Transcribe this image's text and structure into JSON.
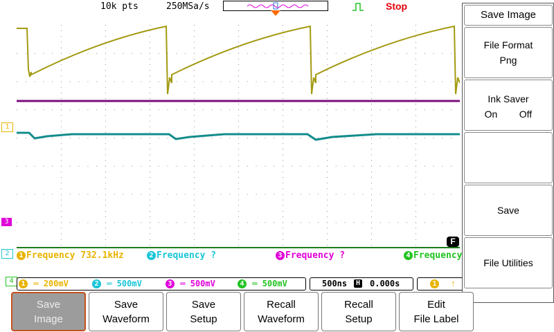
{
  "header": {
    "record_length": "10k pts",
    "sample_rate": "250MSa/s",
    "run_state": "Stop"
  },
  "channel_markers": {
    "ch1": "1",
    "ch2": "2",
    "ch3": "3",
    "ch4": "4"
  },
  "trigger_flag": "F",
  "measurements": [
    {
      "channel": "1",
      "label": "Frequency 732.1kHz",
      "color": "#e8b400"
    },
    {
      "channel": "2",
      "label": "Frequency ?",
      "color": "#19c5d6"
    },
    {
      "channel": "3",
      "label": "Frequency ?",
      "color": "#e000d8"
    },
    {
      "channel": "4",
      "label": "Frequency",
      "color": "#22c322"
    }
  ],
  "channel_scales": [
    {
      "channel": "1",
      "scale": "200mV",
      "color": "#e8b400"
    },
    {
      "channel": "2",
      "scale": "500mV",
      "color": "#19c5d6"
    },
    {
      "channel": "3",
      "scale": "500mV",
      "color": "#e000d8"
    },
    {
      "channel": "4",
      "scale": "500mV",
      "color": "#22c322"
    }
  ],
  "timebase": {
    "scale": "500ns",
    "delay_icon": "H",
    "delay": "0.000s"
  },
  "trigger_box": {
    "channel": "1"
  },
  "side_menu": {
    "title": "Save Image",
    "file_format": {
      "label": "File Format",
      "value": "Png"
    },
    "ink_saver": {
      "label": "Ink Saver",
      "on": "On",
      "off": "Off"
    },
    "blank": "",
    "save": "Save",
    "file_utilities": "File Utilities"
  },
  "softkeys": [
    {
      "line1": "Save",
      "line2": "Image",
      "active": true
    },
    {
      "line1": "Save",
      "line2": "Waveform",
      "active": false
    },
    {
      "line1": "Save",
      "line2": "Setup",
      "active": false
    },
    {
      "line1": "Recall",
      "line2": "Waveform",
      "active": false
    },
    {
      "line1": "Recall",
      "line2": "Setup",
      "active": false
    },
    {
      "line1": "Edit",
      "line2": "File Label",
      "active": false
    }
  ],
  "colors": {
    "ch1": "#b8a800",
    "ch2": "#138c8c",
    "ch3": "#7b0d7b",
    "ch4": "#1e7a1e",
    "grid": "#8c8c8c",
    "trigger_arrow": "#ff6a00",
    "stop": "#e0000a"
  }
}
